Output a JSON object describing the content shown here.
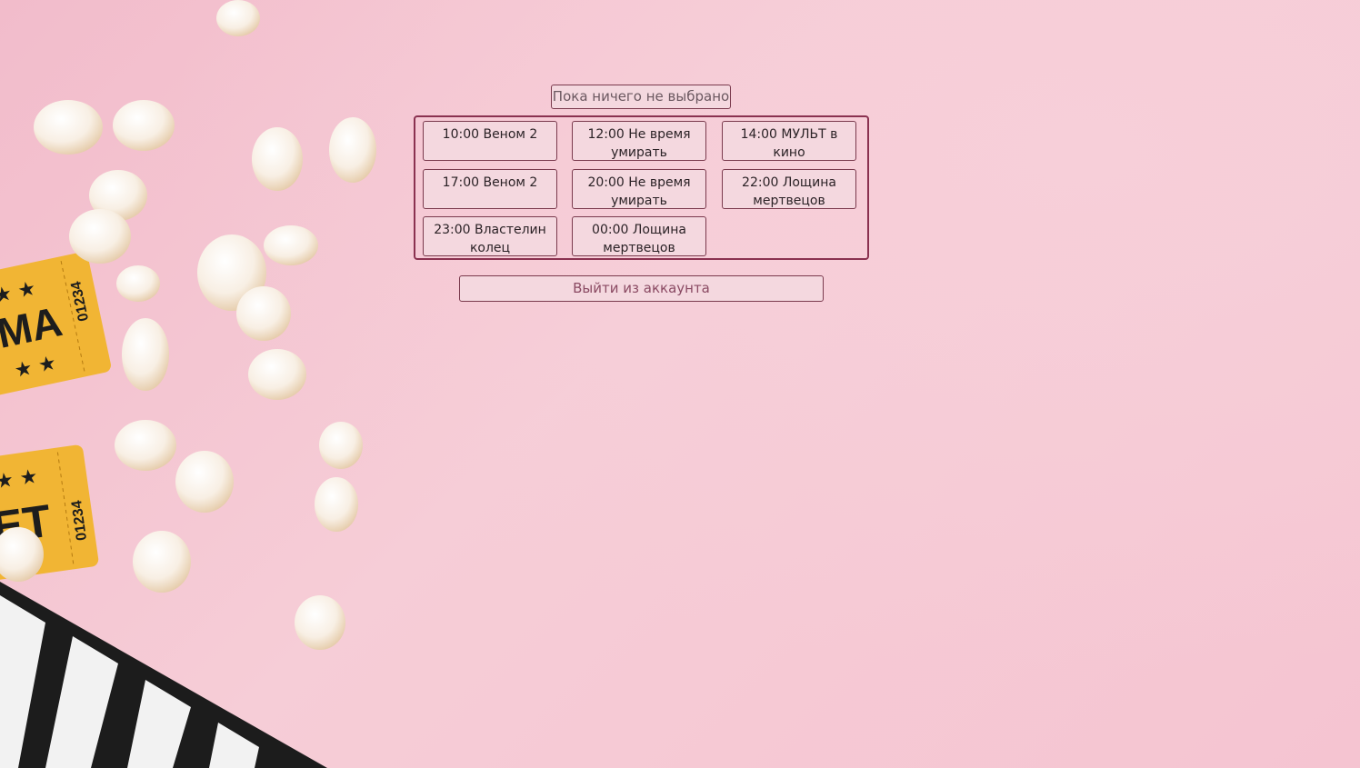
{
  "status": {
    "selection_text": "Пока ничего не выбрано"
  },
  "schedule": {
    "sessions": [
      {
        "label": "10:00 Веном 2"
      },
      {
        "label": "12:00 Не время умирать"
      },
      {
        "label": "14:00 МУЛЬТ в кино"
      },
      {
        "label": "17:00 Веном 2"
      },
      {
        "label": "20:00 Не время умирать"
      },
      {
        "label": "22:00 Лощина мертвецов"
      },
      {
        "label": "23:00 Властелин колец"
      },
      {
        "label": "00:00 Лощина мертвецов"
      }
    ]
  },
  "actions": {
    "logout_label": "Выйти из аккаунта"
  },
  "decor": {
    "ticket_top_text": "MA",
    "ticket_top_number": "01234",
    "ticket_bottom_text": "ET",
    "ticket_bottom_number": "01234"
  },
  "colors": {
    "background": "#f4c6d3",
    "accent_border": "#8a3150",
    "button_fill": "#f4d8df"
  }
}
